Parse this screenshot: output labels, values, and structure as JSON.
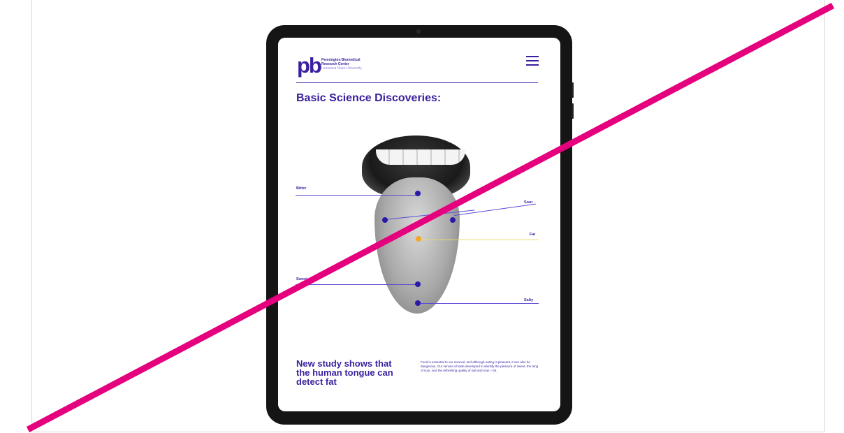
{
  "site": {
    "logo_mark": "pb",
    "logo_line1": "Pennington Biomedical",
    "logo_line2": "Research Center",
    "logo_line3": "Louisiana State University"
  },
  "page": {
    "heading": "Basic Science Discoveries:"
  },
  "diagram": {
    "labels": {
      "bitter": "Bitter",
      "sour": "Sour",
      "fat": "Fat",
      "sweet": "Sweet",
      "salty": "Salty"
    }
  },
  "article": {
    "title": "New study shows that the human tongue can detect fat",
    "body": "Food is essential to our survival, and although eating is pleasant, it can also be dangerous. Our senses of taste developed to identify the pleasure of sweet, the tang of sour, and the refreshing quality of salt and now – fat."
  },
  "colors": {
    "brand": "#3a1f9e",
    "overlay": "#e5007e",
    "fat_marker": "#f2a82a"
  }
}
